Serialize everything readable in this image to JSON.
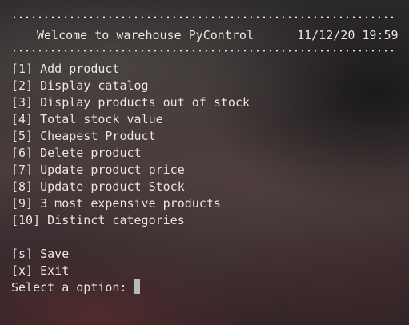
{
  "header": {
    "title": "Welcome to warehouse PyControl",
    "date": "11/12/20",
    "time": "19:59"
  },
  "menu": {
    "items": [
      {
        "key": "[1]",
        "label": "Add product"
      },
      {
        "key": "[2]",
        "label": "Display catalog"
      },
      {
        "key": "[3]",
        "label": "Display products out of stock"
      },
      {
        "key": "[4]",
        "label": "Total stock value"
      },
      {
        "key": "[5]",
        "label": "Cheapest Product"
      },
      {
        "key": "[6]",
        "label": "Delete product"
      },
      {
        "key": "[7]",
        "label": "Update product price"
      },
      {
        "key": "[8]",
        "label": "Update product Stock"
      },
      {
        "key": "[9]",
        "label": "3 most expensive products"
      },
      {
        "key": "[10]",
        "label": "Distinct categories"
      }
    ],
    "extra": [
      {
        "key": "[s]",
        "label": "Save"
      },
      {
        "key": "[x]",
        "label": "Exit"
      }
    ]
  },
  "prompt": {
    "text": "Select a option:"
  },
  "colors": {
    "text": "#ece8e4",
    "cursor": "#b9b9b7"
  }
}
